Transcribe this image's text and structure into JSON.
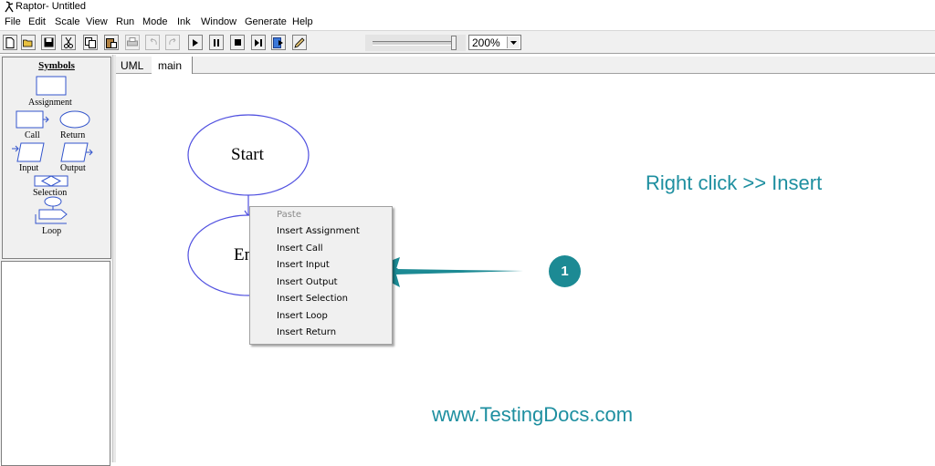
{
  "window": {
    "title": "Raptor- Untitled"
  },
  "menu": [
    "File",
    "Edit",
    "Scale",
    "View",
    "Run",
    "Mode",
    "Ink",
    "Window",
    "Generate",
    "Help"
  ],
  "toolbar": {
    "buttons": [
      "new-icon",
      "open-icon",
      "save-icon",
      "cut-icon",
      "copy-icon",
      "paste-icon",
      "print-icon",
      "undo-icon",
      "redo-icon",
      "play-icon",
      "pause-icon",
      "stop-icon",
      "step-icon",
      "run-compiled-icon",
      "pen-icon"
    ],
    "zoom": "200%"
  },
  "symbols": {
    "header": "Symbols",
    "items": [
      "Assignment",
      "Call",
      "Return",
      "Input",
      "Output",
      "Selection",
      "Loop"
    ]
  },
  "tabs": [
    "UML",
    "main"
  ],
  "flowchart": {
    "start": "Start",
    "end": "End"
  },
  "context_menu": {
    "items": [
      "Paste",
      "Insert Assignment",
      "Insert Call",
      "Insert Input",
      "Insert Output",
      "Insert Selection",
      "Insert Loop",
      "Insert Return"
    ],
    "disabled": [
      "Paste"
    ]
  },
  "annotations": {
    "instruction": "Right click >> Insert",
    "step_number": "1",
    "website": "www.TestingDocs.com",
    "accent_color": "#1e8fa0"
  }
}
